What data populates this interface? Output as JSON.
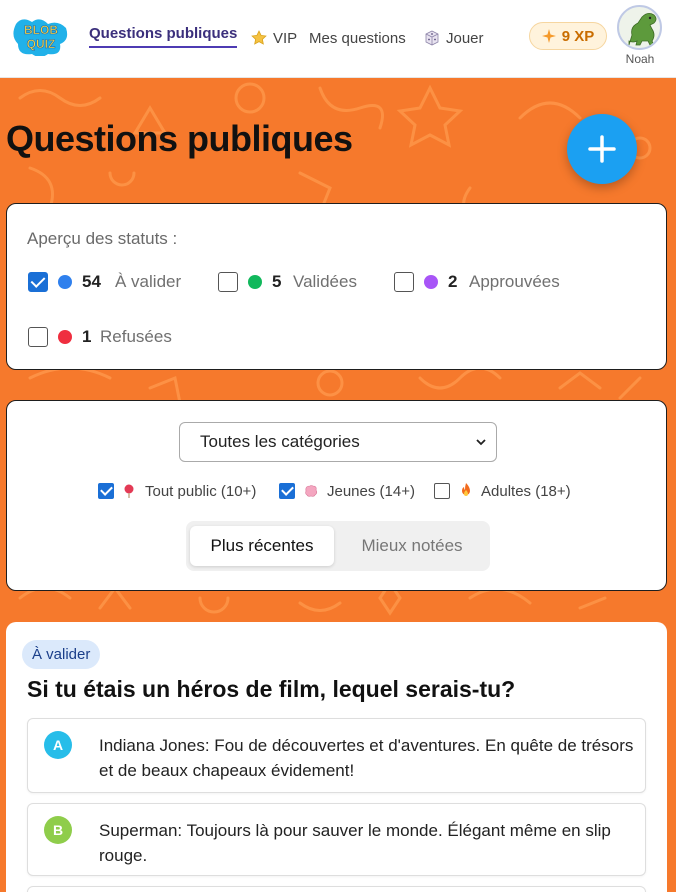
{
  "header": {
    "logo_text": "BLOB QUIZ",
    "nav": {
      "public": "Questions publiques",
      "vip": "VIP",
      "my_questions": "Mes questions",
      "play": "Jouer"
    },
    "xp_label": "9 XP",
    "user_name": "Noah",
    "icons": {
      "vip": "star-icon",
      "play": "dice-icon",
      "xp": "sparkle-icon",
      "avatar": "dinosaur-avatar"
    }
  },
  "page": {
    "title": "Questions publiques",
    "add_button_icon": "plus-icon"
  },
  "status_overview": {
    "title": "Aperçu des statuts :",
    "items": [
      {
        "count": "54",
        "label": "À valider",
        "checked": true,
        "color": "#2f80ed"
      },
      {
        "count": "5",
        "label": "Validées",
        "checked": false,
        "color": "#11b85c"
      },
      {
        "count": "2",
        "label": "Approuvées",
        "checked": false,
        "color": "#a855f7"
      },
      {
        "count": "1",
        "label": "Refusées",
        "checked": false,
        "color": "#ef2e3f"
      }
    ]
  },
  "filters": {
    "category_selected": "Toutes les catégories",
    "age_groups": [
      {
        "label": "Tout public (10+)",
        "checked": true,
        "icon": "lollipop-icon"
      },
      {
        "label": "Jeunes (14+)",
        "checked": true,
        "icon": "brain-icon"
      },
      {
        "label": "Adultes (18+)",
        "checked": false,
        "icon": "fire-icon"
      }
    ],
    "sort": {
      "active": "Plus récentes",
      "inactive": "Mieux notées"
    }
  },
  "question": {
    "status_badge": "À valider",
    "text": "Si tu étais un héros de film, lequel serais-tu?",
    "answers": [
      {
        "letter": "A",
        "text": "Indiana Jones: Fou de découvertes et d'aventures. En quête de trésors et de beaux chapeaux évidement!",
        "color": "#27bde9"
      },
      {
        "letter": "B",
        "text": "Superman: Toujours là pour sauver le monde. Élégant même en slip rouge.",
        "color": "#8fcd4b"
      }
    ]
  },
  "colors": {
    "background": "#f6792c",
    "primary_nav": "#4d3bb3",
    "fab": "#1ba0f2",
    "xp": "#c96d00"
  }
}
